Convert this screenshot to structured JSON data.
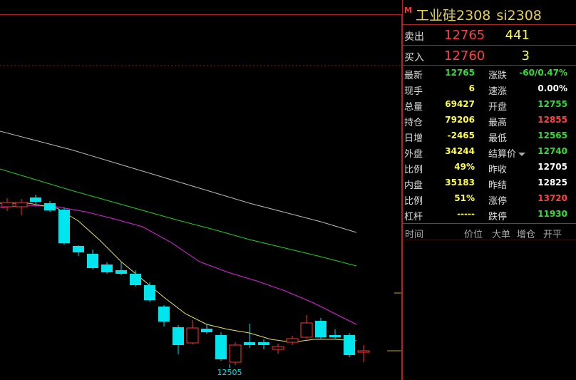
{
  "instrument": {
    "badge": "M",
    "name": "工业硅2308",
    "code": "si2308"
  },
  "quotes": {
    "sell": {
      "label": "卖出",
      "price": "12765",
      "volume": "441"
    },
    "buy": {
      "label": "买入",
      "price": "12760",
      "volume": "3"
    }
  },
  "stats": [
    {
      "l_label": "最新",
      "l_value": "12765",
      "l_color": "#33dd33",
      "r_label": "涨跌",
      "r_value": "-60/0.47%",
      "r_color": "#33dd33"
    },
    {
      "l_label": "现手",
      "l_value": "6",
      "l_color": "#ffff40",
      "r_label": "速涨",
      "r_value": "0.00%",
      "r_color": "#ffffff"
    },
    {
      "l_label": "总量",
      "l_value": "69427",
      "l_color": "#ffff40",
      "r_label": "开盘",
      "r_value": "12755",
      "r_color": "#33dd33"
    },
    {
      "l_label": "持仓",
      "l_value": "79206",
      "l_color": "#ffff40",
      "r_label": "最高",
      "r_value": "12855",
      "r_color": "#ff4040"
    },
    {
      "l_label": "日增",
      "l_value": "-2465",
      "l_color": "#ffff40",
      "r_label": "最低",
      "r_value": "12565",
      "r_color": "#33dd33"
    },
    {
      "l_label": "外盘",
      "l_value": "34244",
      "l_color": "#ffff40",
      "r_label": "结算价",
      "r_value": "12740",
      "r_color": "#33dd33"
    },
    {
      "l_label": "比例",
      "l_value": "49%",
      "l_color": "#ffff40",
      "r_label": "昨收",
      "r_value": "12705",
      "r_color": "#ffffff"
    },
    {
      "l_label": "内盘",
      "l_value": "35183",
      "l_color": "#ffff40",
      "r_label": "昨结",
      "r_value": "12825",
      "r_color": "#ffffff"
    },
    {
      "l_label": "比例",
      "l_value": "51%",
      "l_color": "#ffff40",
      "r_label": "涨停",
      "r_value": "13720",
      "r_color": "#ff4040"
    },
    {
      "l_label": "杠杆",
      "l_value": "-----",
      "l_color": "#ffff40",
      "r_label": "跌停",
      "r_value": "11930",
      "r_color": "#33dd33"
    }
  ],
  "tick_header": {
    "time": "时间",
    "price": "价位",
    "big_order": "大单",
    "position_change": "增仓",
    "open_close": "开平"
  },
  "chart_low_label": "12505",
  "colors": {
    "up": "#ff3333",
    "down": "#00e5ee",
    "ma_white": "#b8b8b8",
    "ma_green": "#22cc22",
    "ma_magenta": "#dd22dd",
    "ma_yellow": "#e8e060"
  }
}
